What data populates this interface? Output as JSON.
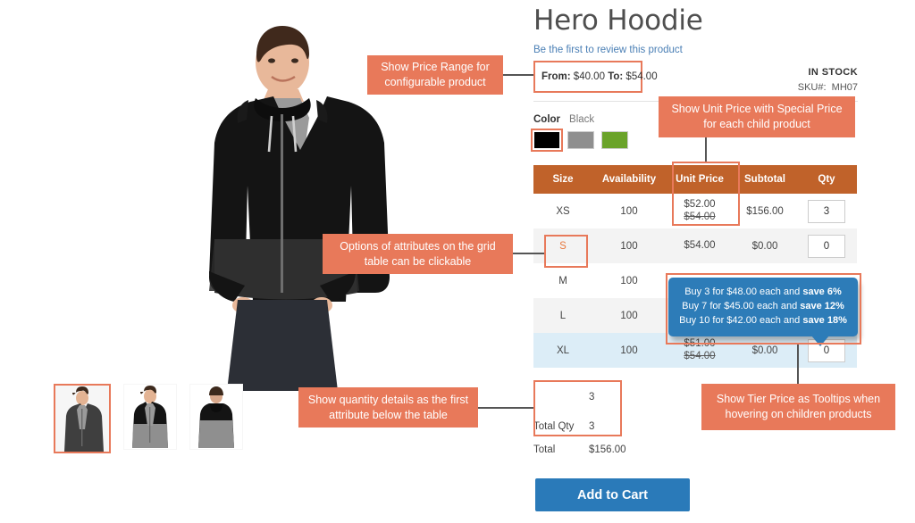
{
  "product": {
    "title": "Hero Hoodie",
    "review_link": "Be the first to review this product",
    "price_range": {
      "from_label": "From:",
      "from_value": "$40.00",
      "to_label": "To:",
      "to_value": "$54.00"
    },
    "stock_status": "IN STOCK",
    "sku_label": "SKU#:",
    "sku_value": "MH07"
  },
  "swatch": {
    "label": "Color",
    "selected_value": "Black",
    "options": [
      {
        "name": "Black",
        "hex": "#000000",
        "selected": true
      },
      {
        "name": "Gray",
        "hex": "#8f8f8f",
        "selected": false
      },
      {
        "name": "Green",
        "hex": "#6aa32a",
        "selected": false
      }
    ]
  },
  "grid": {
    "headers": [
      "Size",
      "Availability",
      "Unit Price",
      "Subtotal",
      "Qty"
    ],
    "rows": [
      {
        "size": "XS",
        "size_is_link": false,
        "availability": "100",
        "price": "$52.00",
        "price_old": "$54.00",
        "subtotal": "$156.00",
        "qty": "3",
        "style": "plain"
      },
      {
        "size": "S",
        "size_is_link": true,
        "availability": "100",
        "price": "$54.00",
        "price_old": "",
        "subtotal": "$0.00",
        "qty": "0",
        "style": "alt"
      },
      {
        "size": "M",
        "size_is_link": false,
        "availability": "100",
        "price": "",
        "price_old": "",
        "subtotal": "",
        "qty": "",
        "style": "plain"
      },
      {
        "size": "L",
        "size_is_link": false,
        "availability": "100",
        "price": "",
        "price_old": "",
        "subtotal": "",
        "qty": "",
        "style": "alt"
      },
      {
        "size": "XL",
        "size_is_link": false,
        "availability": "100",
        "price": "$51.00",
        "price_old": "$54.00",
        "subtotal": "$0.00",
        "qty": "0",
        "style": "hov"
      }
    ]
  },
  "tier_tooltip": {
    "lines": [
      {
        "text": "Buy 3 for $48.00 each and ",
        "bold": "save 6%"
      },
      {
        "text": "Buy 7 for $45.00 each and ",
        "bold": "save 12%"
      },
      {
        "text": "Buy 10 for $42.00 each and ",
        "bold": "save 18%"
      }
    ]
  },
  "summary": {
    "swatch_hex": "#000000",
    "swatch_qty": "3",
    "total_qty_label": "Total Qty",
    "total_qty_value": "3",
    "total_label": "Total",
    "total_value": "$156.00"
  },
  "add_to_cart_label": "Add to Cart",
  "annotations": {
    "price_range": "Show Price Range for configurable product",
    "unit_price": "Show Unit Price with Special Price for each child product",
    "clickable_options": "Options of attributes on the grid table can be clickable",
    "quantity_details": "Show quantity details as the first attribute below the table",
    "tier_tooltip": "Show Tier Price as Tooltips when hovering on children products"
  },
  "colors": {
    "annotation": "#e8795a",
    "table_header": "#c0622a",
    "tooltip": "#2d7cb8",
    "button": "#2a7ab9",
    "link": "#4a7fb5",
    "row_hover": "#dcedf7",
    "row_alt": "#f3f3f3"
  }
}
